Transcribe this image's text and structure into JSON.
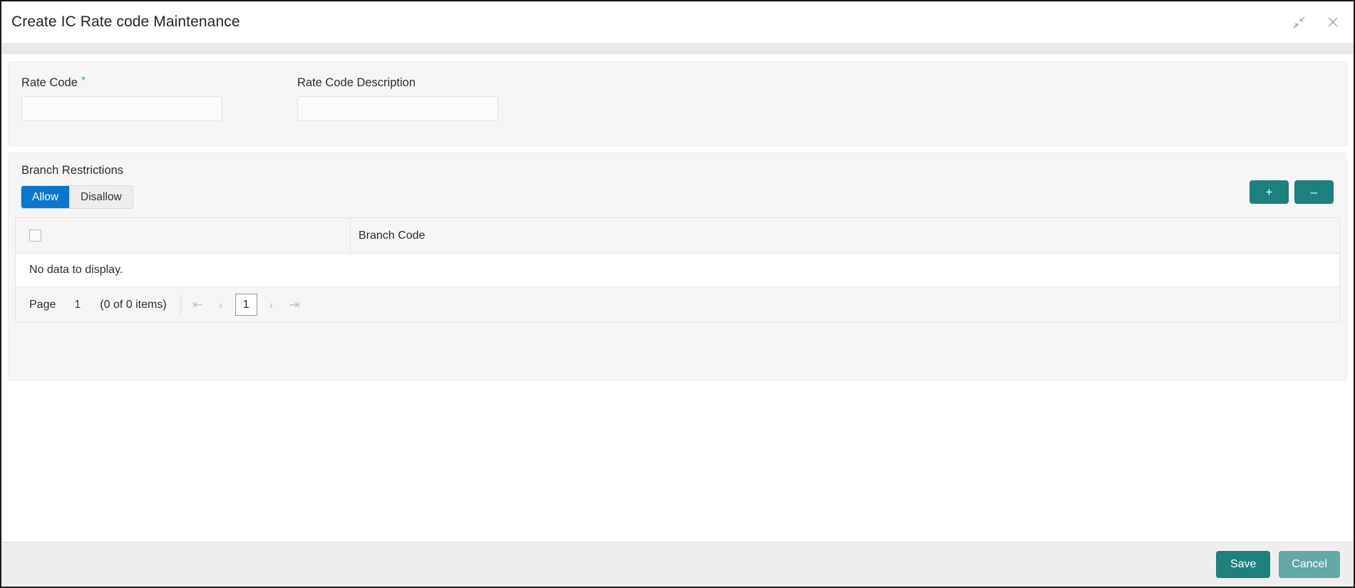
{
  "window": {
    "title": "Create IC Rate code Maintenance",
    "icons": {
      "minimize": "collapse-arrows-icon",
      "close": "close-icon"
    }
  },
  "form": {
    "fields": [
      {
        "label": "Rate Code",
        "required": true,
        "required_marker": "*",
        "value": "",
        "placeholder": ""
      },
      {
        "label": "Rate Code Description",
        "required": false,
        "required_marker": "",
        "value": "",
        "placeholder": ""
      }
    ]
  },
  "branch_restrictions": {
    "title": "Branch Restrictions",
    "toggle": {
      "options": [
        "Allow",
        "Disallow"
      ],
      "selected": "Allow"
    },
    "actions": {
      "add_label": "+",
      "remove_label": "–"
    },
    "grid": {
      "columns": [
        "",
        "Branch Code"
      ],
      "rows": [],
      "empty_message": "No data to display."
    },
    "pagination": {
      "page_label": "Page",
      "page_number": "1",
      "items_label": "(0 of 0 items)",
      "first_icon": "⇤",
      "prev_icon": "‹",
      "current_page": "1",
      "next_icon": "›",
      "last_icon": "⇥"
    }
  },
  "footer": {
    "save_label": "Save",
    "cancel_label": "Cancel"
  },
  "colors": {
    "accent_blue": "#0a76ce",
    "accent_teal": "#1c807d",
    "muted_teal": "#62a8a5",
    "required_star": "#35a3dc"
  }
}
